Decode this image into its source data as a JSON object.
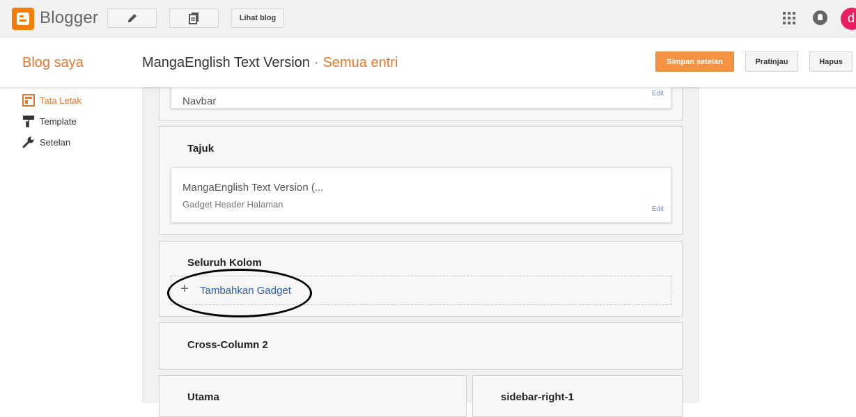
{
  "topbar": {
    "brand": "Blogger",
    "view_blog_label": "Lihat blog",
    "avatar_letter": "d",
    "icons": [
      "pencil-icon",
      "pages-icon",
      "apps-grid-icon",
      "notifications-icon"
    ]
  },
  "header": {
    "my_blogs": "Blog saya",
    "blog_name": "MangaEnglish Text Version",
    "separator": "·",
    "all_posts": "Semua entri",
    "save_label": "Simpan setelan",
    "preview_label": "Pratinjau",
    "delete_label": "Hapus"
  },
  "sidebar": {
    "items": [
      {
        "label": "Tata Letak",
        "icon": "layout-icon",
        "active": true
      },
      {
        "label": "Template",
        "icon": "paint-roller-icon",
        "active": false
      },
      {
        "label": "Setelan",
        "icon": "wrench-icon",
        "active": false
      }
    ]
  },
  "layout": {
    "navbar": {
      "gadget_title": "Navbar",
      "edit_label": "Edit"
    },
    "header_section": {
      "title": "Tajuk",
      "gadget_title": "MangaEnglish Text Version (...",
      "gadget_subtitle": "Gadget Header Halaman",
      "edit_label": "Edit"
    },
    "cross_column": {
      "title": "Seluruh Kolom",
      "add_gadget_label": "Tambahkan Gadget"
    },
    "cross_column_2": {
      "title": "Cross-Column 2"
    },
    "main": {
      "title": "Utama"
    },
    "sidebar_right": {
      "title": "sidebar-right-1"
    }
  },
  "colors": {
    "accent": "#e8772e",
    "save_button": "#f39343",
    "link": "#2a5db0",
    "avatar": "#e91e63"
  }
}
